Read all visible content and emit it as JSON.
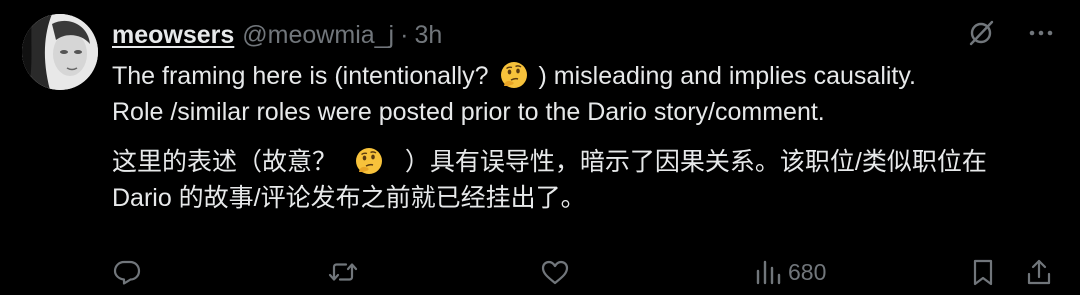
{
  "tweet": {
    "author": {
      "display_name": "meowsers",
      "handle": "@meowmia_j",
      "separator": "·",
      "timestamp": "3h"
    },
    "text_en_line1_before": "The framing here is (intentionally?",
    "text_en_line1_after": ") misleading and implies causality.",
    "text_en_line2": "Role /similar roles were posted prior to the Dario story/comment.",
    "text_cn_line1_before": "这里的表述（故意？",
    "text_cn_line1_after": "）具有误导性，暗示了因果关系。该职位/类似职位在",
    "text_cn_line2": "Dario 的故事/评论发布之前就已经挂出了。",
    "emoji": "thinking-face-emoji",
    "top_icons": [
      "grok-icon",
      "more-icon"
    ],
    "actions": {
      "reply_count": "",
      "retweet_count": "",
      "like_count": "",
      "views_count": "680"
    }
  },
  "colors": {
    "background": "#000000",
    "primary_text": "#e7e9ea",
    "secondary_text": "#71767b"
  }
}
